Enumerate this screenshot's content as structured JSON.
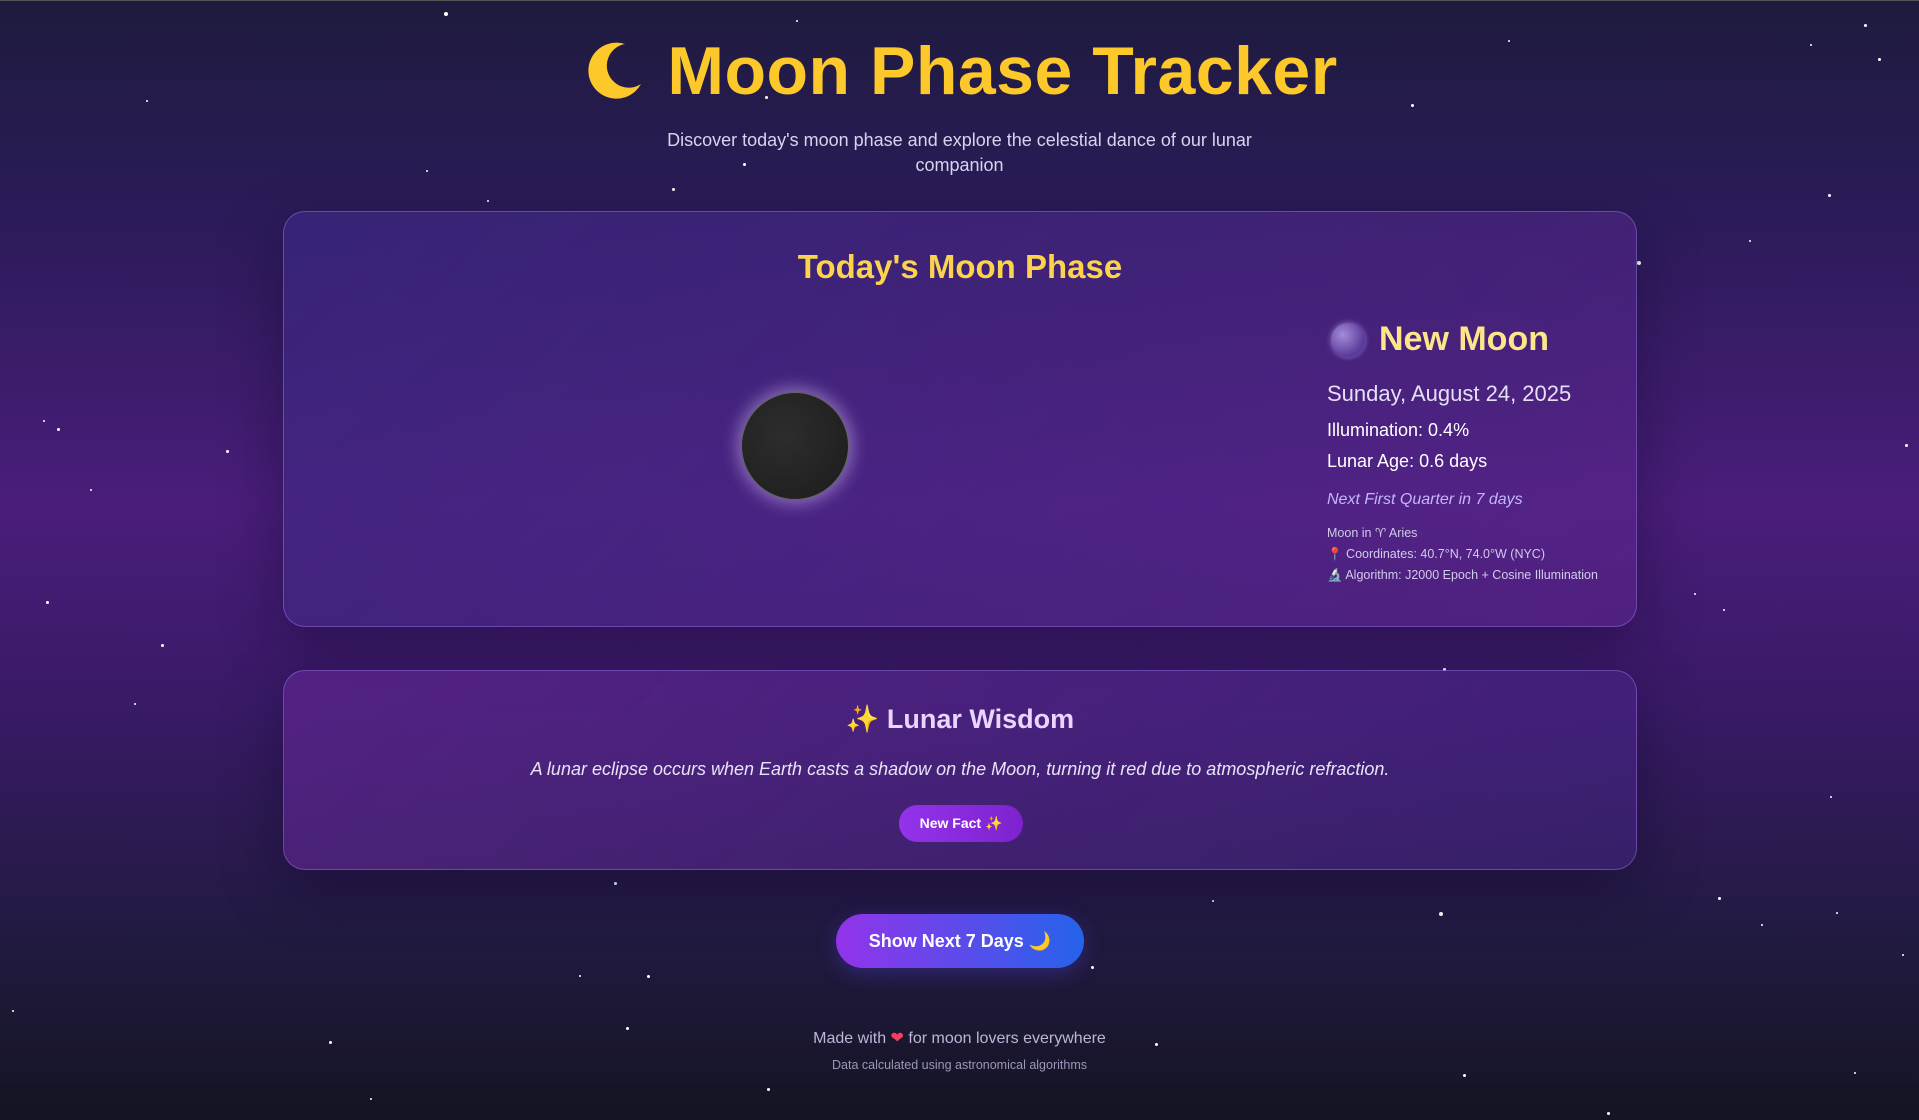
{
  "header": {
    "icon": "crescent-moon-icon",
    "title": "Moon Phase Tracker",
    "subtitle": "Discover today's moon phase and explore the celestial dance of our lunar companion"
  },
  "phase_card": {
    "heading": "Today's Moon Phase",
    "phase_name": "New Moon",
    "date": "Sunday, August 24, 2025",
    "illumination": "Illumination: 0.4%",
    "lunar_age": "Lunar Age: 0.6 days",
    "next_phase": "Next First Quarter in 7 days",
    "zodiac": "Moon in ♈ Aries",
    "coordinates": "📍 Coordinates: 40.7°N, 74.0°W (NYC)",
    "algorithm": "🔬 Algorithm: J2000 Epoch + Cosine Illumination"
  },
  "wisdom_card": {
    "heading": "✨ Lunar Wisdom",
    "fact": "A lunar eclipse occurs when Earth casts a shadow on the Moon, turning it red due to atmospheric refraction.",
    "new_fact_button": "New Fact ✨"
  },
  "actions": {
    "show_week_button": "Show Next 7 Days 🌙"
  },
  "footer": {
    "made_with_prefix": "Made with",
    "heart": "❤",
    "made_with_suffix": "for moon lovers everywhere",
    "note": "Data calculated using astronomical algorithms"
  },
  "colors": {
    "title": "#fcc82a",
    "accent_purple": "#9333ea",
    "accent_blue": "#2563eb"
  }
}
